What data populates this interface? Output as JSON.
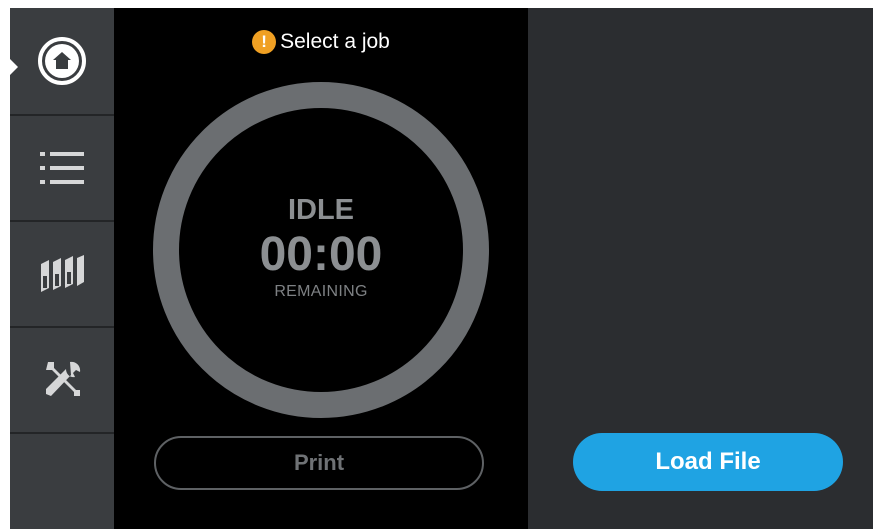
{
  "sidebar": {
    "items": [
      {
        "icon": "home-icon",
        "active": true
      },
      {
        "icon": "list-icon",
        "active": false
      },
      {
        "icon": "filament-spools-icon",
        "active": false
      },
      {
        "icon": "tools-icon",
        "active": false
      }
    ]
  },
  "status": {
    "icon": "warning-icon",
    "icon_glyph": "!",
    "message": "Select a job"
  },
  "timer": {
    "state": "IDLE",
    "time": "00:00",
    "caption": "REMAINING"
  },
  "buttons": {
    "print_label": "Print",
    "load_file_label": "Load File"
  },
  "colors": {
    "accent": "#1fa3e3",
    "warning": "#f0a023",
    "ring": "#6b6e71",
    "sidebar": "#3a3d40"
  }
}
